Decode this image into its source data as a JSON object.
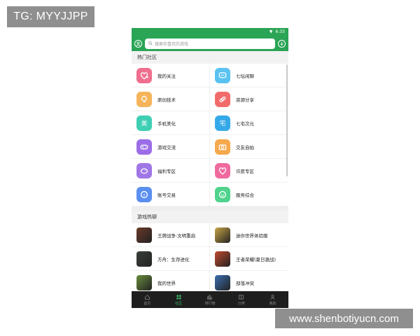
{
  "watermark": {
    "top": "TG: MYYJJPP",
    "bottom": "www.shenbotiyucn.com"
  },
  "status": {
    "time": "6:33"
  },
  "search": {
    "placeholder": "搜索你喜欢的游戏"
  },
  "hot_community": {
    "title": "热门社区",
    "items": [
      {
        "label": "我的关注",
        "color": "#f06e8e",
        "icon": "heart-plus-icon"
      },
      {
        "label": "七坛闲聊",
        "color": "#59c2f0",
        "icon": "chat-bubble-icon"
      },
      {
        "label": "原创技术",
        "color": "#f5b45a",
        "icon": "lightbulb-icon"
      },
      {
        "label": "资源分享",
        "color": "#f26b6b",
        "icon": "link-icon"
      },
      {
        "label": "手机美化",
        "color": "#3fcfb4",
        "icon": "beauty-icon"
      },
      {
        "label": "七宅次元",
        "color": "#35a9e8",
        "icon": "otaku-icon"
      },
      {
        "label": "游戏交流",
        "color": "#9b6ee8",
        "icon": "gamepad-icon"
      },
      {
        "label": "交友自拍",
        "color": "#f5a84c",
        "icon": "camera-icon"
      },
      {
        "label": "福利专区",
        "color": "#a076e6",
        "icon": "piggy-bank-icon"
      },
      {
        "label": "许愿专区",
        "color": "#f06aa0",
        "icon": "heart-icon"
      },
      {
        "label": "账号交易",
        "color": "#5b8ff0",
        "icon": "trade-icon"
      },
      {
        "label": "服务综合",
        "color": "#4fd28c",
        "icon": "service-icon"
      }
    ]
  },
  "game_hot": {
    "title": "游戏热聊",
    "items": [
      {
        "label": "王牌战争:文明重启",
        "color": "#6b3a2a"
      },
      {
        "label": "迷你世界体验服",
        "color": "#c8a545"
      },
      {
        "label": "方舟：生存进化",
        "color": "#3a3f3a"
      },
      {
        "label": "王者荣耀(夏日激战)",
        "color": "#c24a2e"
      },
      {
        "label": "我的世界",
        "color": "#6a8d3c"
      },
      {
        "label": "部落冲突",
        "color": "#3b6fb0"
      }
    ]
  },
  "tabs": [
    {
      "label": "首页",
      "icon": "home-icon"
    },
    {
      "label": "社区",
      "icon": "community-icon",
      "active": true
    },
    {
      "label": "排行榜",
      "icon": "ranking-icon"
    },
    {
      "label": "分类",
      "icon": "category-icon"
    },
    {
      "label": "我的",
      "icon": "profile-icon"
    }
  ]
}
